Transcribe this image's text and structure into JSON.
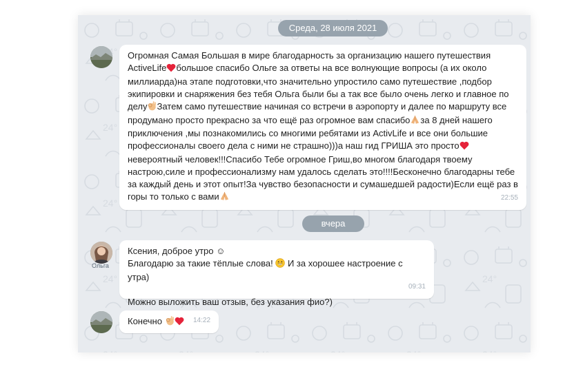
{
  "date_dividers": {
    "first": "Среда, 28 июля 2021",
    "second": "вчера"
  },
  "messages": [
    {
      "author": "",
      "time": "22:55",
      "parts": {
        "p1": "Огромная Самая Большая в мире благодарность за организацию нашего путешествия ActiveLife",
        "p2": "большое спасибо Ольге за ответы на все волнующие вопросы (а их около миллиарда)на этапе подготовки,что значительно упростило само путешествие ,подбор экипировки и снаряжения без тебя Ольга были бы а так все было очень легко и главное по делу",
        "p3": "Затем само путешествие начиная со встречи в аэропорту и далее по маршруту все продумано просто прекрасно за что ещё раз огромное вам спасибо",
        "p4": "за 8 дней нашего приключения ,мы познакомились со многими ребятами из ActivLife и все они большие профессионалы своего дела с ними не страшно)))а наш гид ГРИША это просто",
        "p5": "невероятный человек!!!Спасибо Тебе огромное Гриш,во многом благодаря твоему настрою,силе и профессионализму нам удалось сделать это!!!!Бесконечно благодарны тебе за каждый день и этот опыт!За чувство безопасности и сумашедшей радости)Если ещё раз в горы то только с вами"
      }
    },
    {
      "author": "Ольга",
      "time": "09:31",
      "line1": "Ксения, доброе утро ☺",
      "line2a": "Благодарю за такие тёплые слова!",
      "line2b": "И за хорошее настроение с утра)",
      "line3": "Можно выложить ваш отзыв, без указания фио?)"
    },
    {
      "author": "",
      "time": "14:22",
      "text": "Конечно"
    }
  ],
  "icons": [
    "heart-icon",
    "ok-hand-icon",
    "praying-hands-icon",
    "grinning-face-icon",
    "smile-icon"
  ],
  "colors": {
    "chat_background": "#e8ebef",
    "date_pill": "#97a3ad",
    "bubble": "#ffffff",
    "time": "#a6b0ba",
    "heart": "#e5233a"
  }
}
